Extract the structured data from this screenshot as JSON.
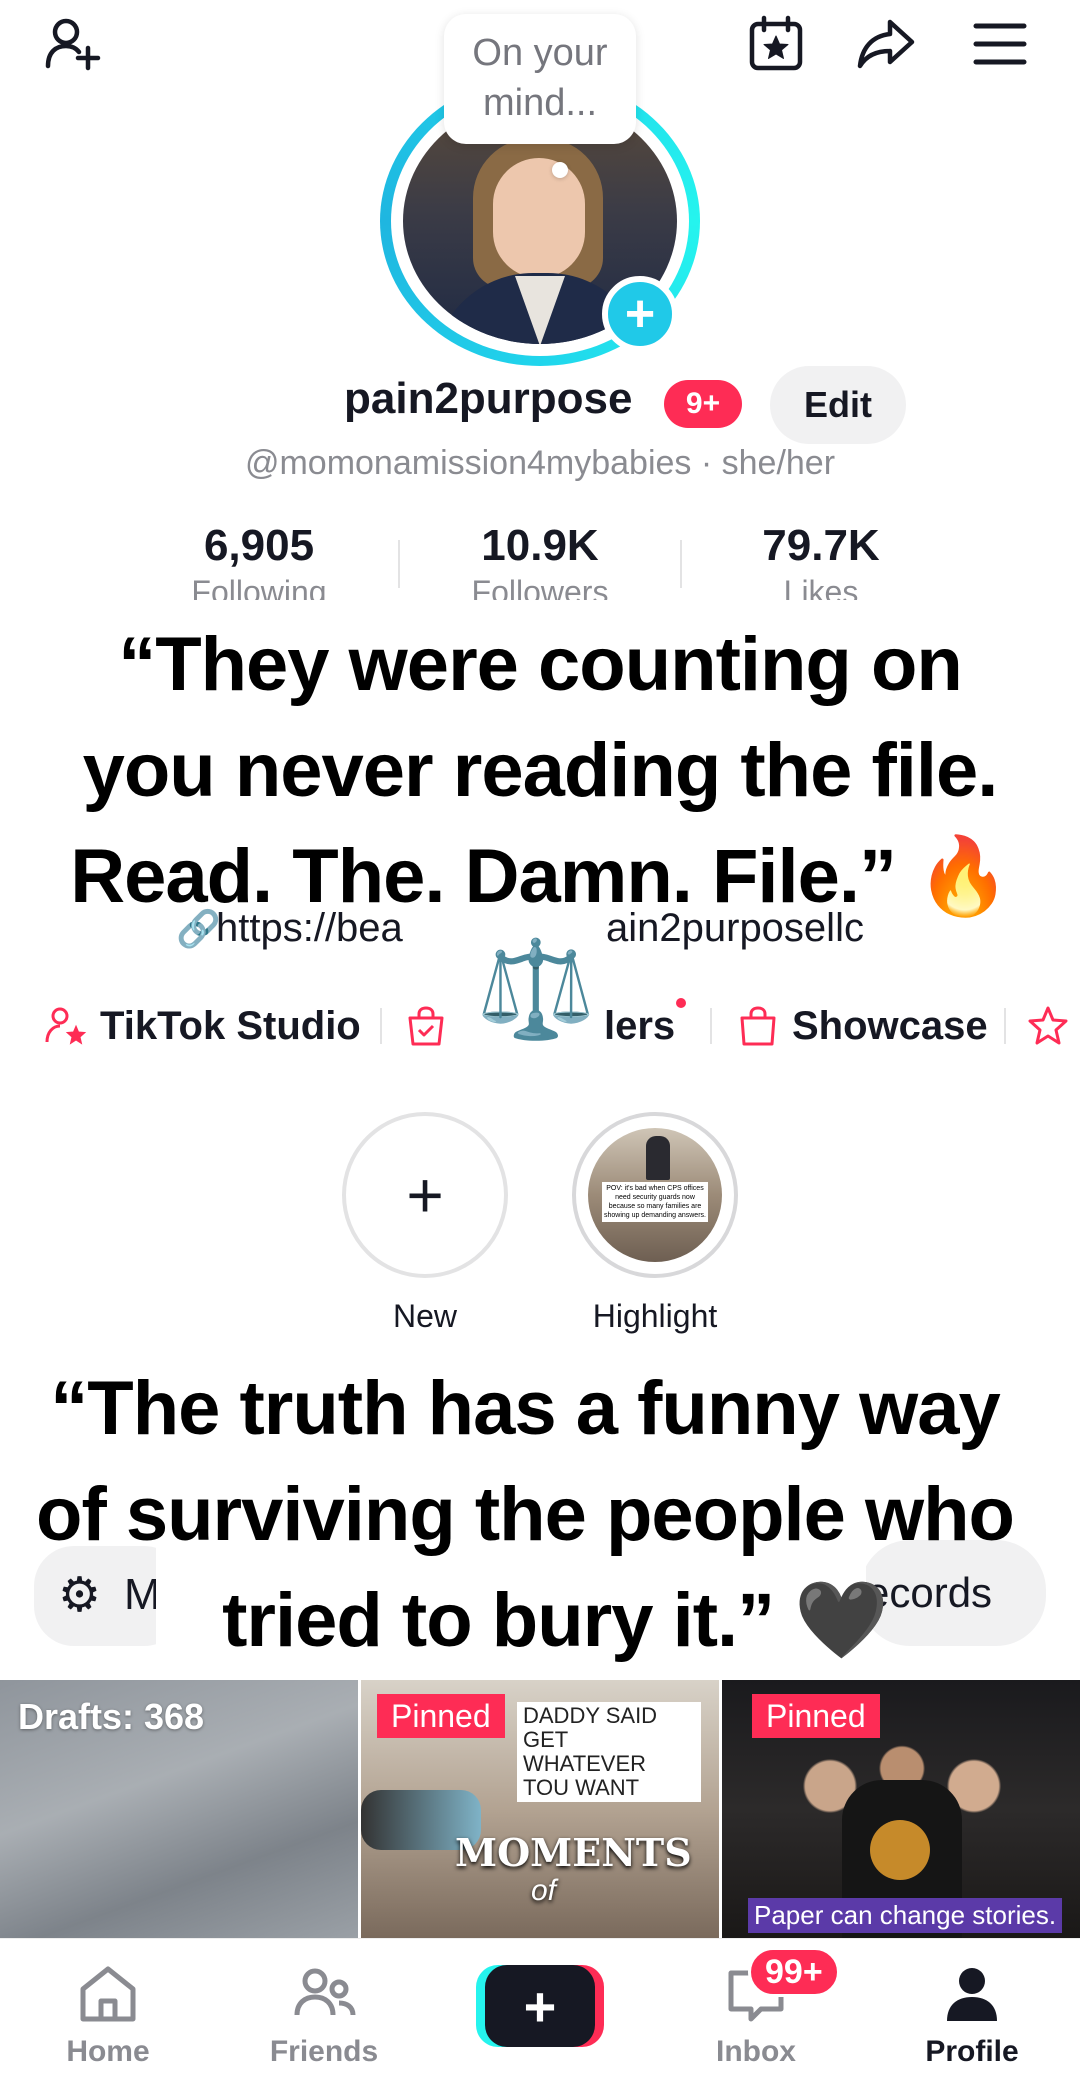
{
  "header": {
    "speech_bubble": "On your mind...",
    "username": "pain2purpose",
    "notification_badge": "9+",
    "edit_label": "Edit",
    "handle": "@momonamission4mybabies · she/her"
  },
  "stats": [
    {
      "value": "6,905",
      "label": "Following"
    },
    {
      "value": "10.9K",
      "label": "Followers"
    },
    {
      "value": "79.7K",
      "label": "Likes"
    }
  ],
  "captions": {
    "quote1_line1": "“They were counting on",
    "quote1_line2": "you never reading the file.",
    "quote1_line3": "Read. The. Damn. File.” 🔥",
    "quote2_line1": "“The truth has a funny way",
    "quote2_line2": "of surviving the people who",
    "quote2_line3": "tried to bury it.” 🖤"
  },
  "link": {
    "text_left": "https://bea",
    "text_right": "ain2purposellc",
    "scales_emoji": "⚖️"
  },
  "tools": {
    "studio": "TikTok Studio",
    "orders": "lers",
    "showcase": "Showcase"
  },
  "highlights": {
    "new_label": "New",
    "highlight_label": "Highlight",
    "highlight_thumb_text": "POV: it's bad when CPS offices need security guards now because so many families are showing up demanding answers."
  },
  "pills": {
    "left_letter": "M",
    "right_text": "ecords"
  },
  "grid": {
    "drafts": "Drafts: 368",
    "pinned": "Pinned",
    "tile2_note": "DADDY SAID GET WHATEVER TOU WANT",
    "tile2_title": "MOMENTS",
    "tile2_of": "of",
    "tile3_caption": "Paper can change stories."
  },
  "nav": {
    "home": "Home",
    "friends": "Friends",
    "inbox": "Inbox",
    "inbox_badge": "99+",
    "profile": "Profile"
  },
  "colors": {
    "accent_red": "#fe2c55",
    "accent_cyan": "#25f4ee",
    "text_primary": "#161823",
    "text_secondary": "#8a8b91"
  }
}
